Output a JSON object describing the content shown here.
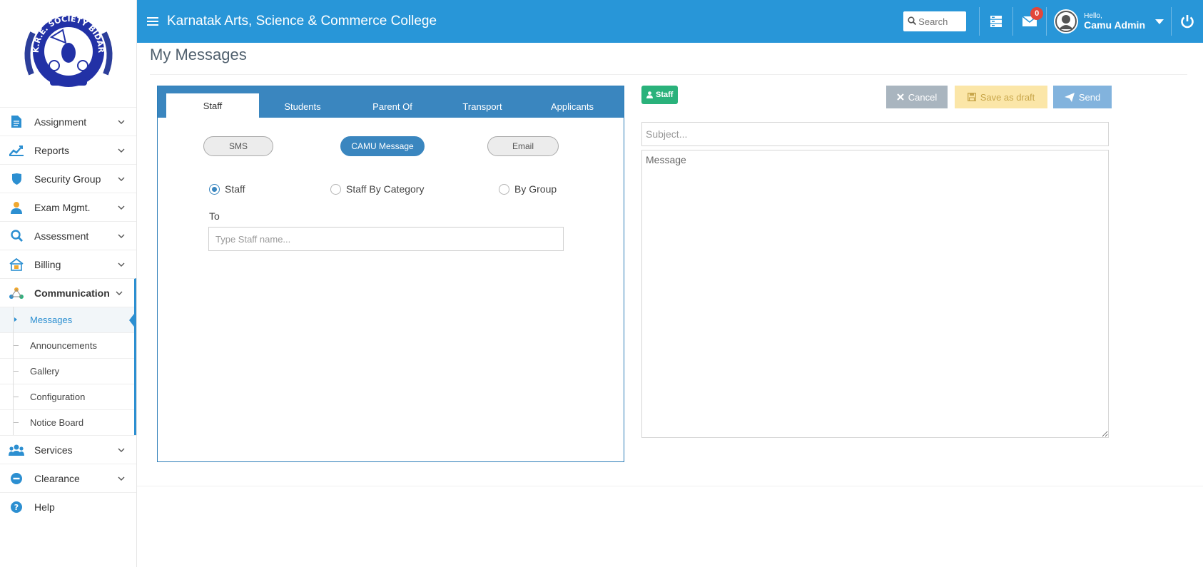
{
  "logo": {
    "text_top": "K.R.E. SOCIETY BIDAR"
  },
  "sidebar": {
    "items": [
      {
        "label": "Assignment"
      },
      {
        "label": "Reports"
      },
      {
        "label": "Security Group"
      },
      {
        "label": "Exam Mgmt."
      },
      {
        "label": "Assessment"
      },
      {
        "label": "Billing"
      },
      {
        "label": "Communication"
      }
    ],
    "sub_items": [
      {
        "label": "Messages"
      },
      {
        "label": "Announcements"
      },
      {
        "label": "Gallery"
      },
      {
        "label": "Configuration"
      },
      {
        "label": "Notice Board"
      }
    ],
    "bottom_items": [
      {
        "label": "Services"
      },
      {
        "label": "Clearance"
      },
      {
        "label": "Help"
      }
    ]
  },
  "topbar": {
    "title": "Karnatak Arts, Science & Commerce College",
    "search_placeholder": "Search",
    "mail_count": "0",
    "hello": "Hello,",
    "user_name": "Camu Admin"
  },
  "page": {
    "title": "My Messages"
  },
  "compose": {
    "tabs": [
      "Staff",
      "Students",
      "Parent Of",
      "Transport",
      "Applicants"
    ],
    "channels": [
      "SMS",
      "CAMU Message",
      "Email"
    ],
    "radios": [
      "Staff",
      "Staff By Category",
      "By Group"
    ],
    "to_label": "To",
    "to_placeholder": "Type Staff name...",
    "staff_tag": "Staff",
    "cancel_label": "Cancel",
    "draft_label": "Save as draft",
    "send_label": "Send",
    "subject_placeholder": "Subject...",
    "message_placeholder": "Message"
  },
  "colors": {
    "topbar": "#2896d8",
    "accent": "#3a86bf",
    "badge": "#e2463a",
    "staff_tag": "#2ab27b"
  }
}
